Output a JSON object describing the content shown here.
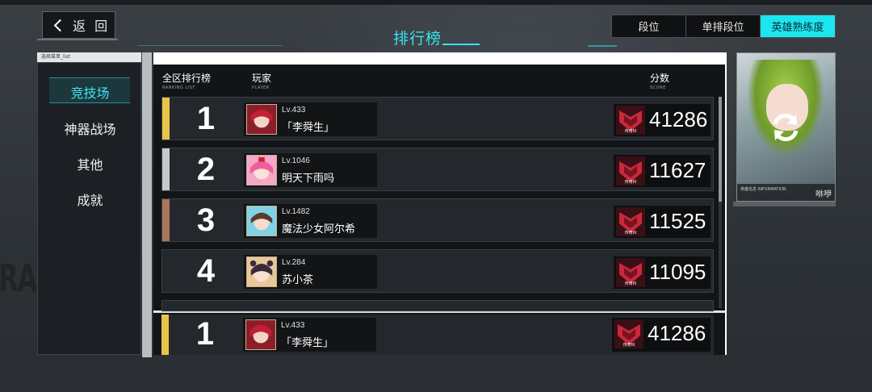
{
  "header": {
    "back_label": "返 回",
    "title": "排行榜"
  },
  "tabs": [
    {
      "label": "段位",
      "active": false
    },
    {
      "label": "单排段位",
      "active": false
    },
    {
      "label": "英雄熟练度",
      "active": true
    }
  ],
  "menu": {
    "header_label": "选择菜单_list",
    "items": [
      {
        "label": "竞技场",
        "active": true
      },
      {
        "label": "神器战场",
        "active": false
      },
      {
        "label": "其他",
        "active": false
      },
      {
        "label": "成就",
        "active": false
      }
    ]
  },
  "columns": {
    "rank": "全区排行榜",
    "rank_sub": "RANKING LIST",
    "player": "玩家",
    "player_sub": "PLAYER",
    "score": "分数",
    "score_sub": "SCORE"
  },
  "rows": [
    {
      "rank": "1",
      "level": "Lv.433",
      "name": "「李舜生」",
      "score": "41286",
      "accent": "#e9c44a"
    },
    {
      "rank": "2",
      "level": "Lv.1046",
      "name": "明天下雨吗",
      "score": "11627",
      "accent": "#c8c8c8"
    },
    {
      "rank": "3",
      "level": "Lv.1482",
      "name": "魔法少女阿尔希",
      "score": "11525",
      "accent": "#a8765a"
    },
    {
      "rank": "4",
      "level": "Lv.284",
      "name": "苏小茶",
      "score": "11095",
      "accent": ""
    }
  ],
  "my_rank": {
    "rank": "1",
    "level": "Lv.433",
    "name": "「李舜生」",
    "score": "41286"
  },
  "rank_badge_text": "传奇III",
  "hero": {
    "info_label": "英雄信息 INFORMATION",
    "name": "咻咿"
  },
  "colors": {
    "accent_cyan": "#1de6f0",
    "gold": "#e9c44a",
    "silver": "#c8c8c8",
    "bronze": "#a8765a",
    "badge_red": "#c9283b"
  },
  "icons": {
    "back": "chevron-left-icon",
    "refresh": "refresh-icon",
    "rank_badge": "legend-rank-badge-icon"
  }
}
